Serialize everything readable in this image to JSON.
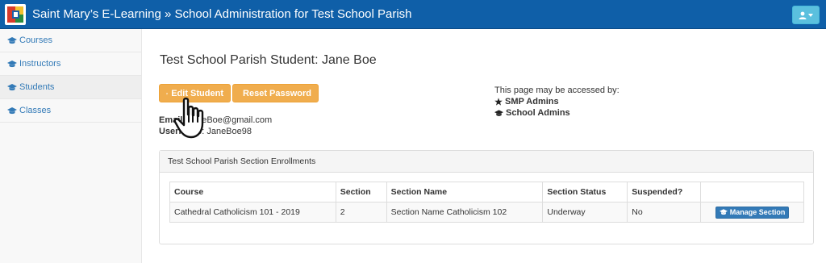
{
  "header": {
    "app_title": "Saint Mary’s E-Learning » School Administration for Test School Parish",
    "colors": {
      "bar": "#0f5fa8",
      "user_button": "#5bc0de"
    }
  },
  "sidebar": {
    "items": [
      {
        "label": "Courses",
        "icon": "graduation-cap-icon"
      },
      {
        "label": "Instructors",
        "icon": "graduation-cap-icon"
      },
      {
        "label": "Students",
        "icon": "graduation-cap-icon",
        "active": true
      },
      {
        "label": "Classes",
        "icon": "graduation-cap-icon"
      }
    ]
  },
  "page": {
    "title": "Test School Parish Student: Jane Boe",
    "buttons": {
      "edit": "Edit Student",
      "reset": "Reset Password"
    },
    "email_label": "Email",
    "email_value": "JaneBoe@gmail.com",
    "username_label": "Username",
    "username_value": "JaneBoe98",
    "access": {
      "intro": "This page may be accessed by:",
      "roles": [
        {
          "label": "SMP Admins",
          "icon": "star-icon"
        },
        {
          "label": "School Admins",
          "icon": "graduation-cap-icon"
        }
      ]
    }
  },
  "enrollments": {
    "heading": "Test School Parish Section Enrollments",
    "columns": [
      "Course",
      "Section",
      "Section Name",
      "Section Status",
      "Suspended?",
      ""
    ],
    "rows": [
      {
        "course": "Cathedral Catholicism 101 - 2019",
        "section": "2",
        "section_name": "Section Name Catholicism 102",
        "status": "Underway",
        "suspended": "No",
        "action": "Manage Section"
      }
    ]
  },
  "colors": {
    "warning_button": "#f0ad4e",
    "primary_button": "#337ab7",
    "link": "#337ab7"
  }
}
